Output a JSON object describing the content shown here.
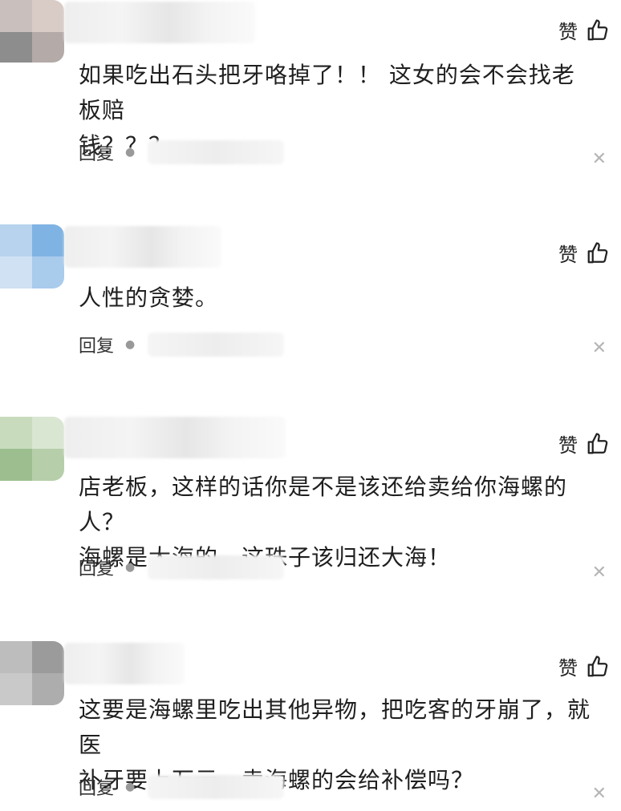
{
  "comments": [
    {
      "like_label": "赞",
      "lines": [
        "如果吃出石头把牙咯掉了！！ 这女的会不会找老板赔",
        "钱？？？"
      ],
      "reply_label": "回复",
      "avatar_colors": [
        "#b9b0ae",
        "#d8c9c4",
        "#8f8f8f"
      ]
    },
    {
      "like_label": "赞",
      "lines": [
        "人性的贪婪。"
      ],
      "reply_label": "回复",
      "avatar_colors": [
        "#9fc6ea",
        "#c6ddf2",
        "#7db2e2"
      ]
    },
    {
      "like_label": "赞",
      "lines": [
        "店老板，这样的话你是不是该还给卖给你海螺的人？",
        "海螺是大海的，这珠子该归还大海！"
      ],
      "reply_label": "回复",
      "avatar_colors": [
        "#a9c79c",
        "#cfe0c6",
        "#96b98a"
      ]
    },
    {
      "like_label": "赞",
      "lines": [
        "这要是海螺里吃出其他异物，把吃客的牙崩了，就医",
        "补牙要上万元，卖海螺的会给补偿吗？"
      ],
      "reply_label": "回复",
      "avatar_colors": [
        "#a6a6a6",
        "#cfcfcf",
        "#8c8c8c"
      ]
    }
  ],
  "icons": {
    "like": "thumbs-up-icon",
    "dismiss": "close-icon"
  }
}
